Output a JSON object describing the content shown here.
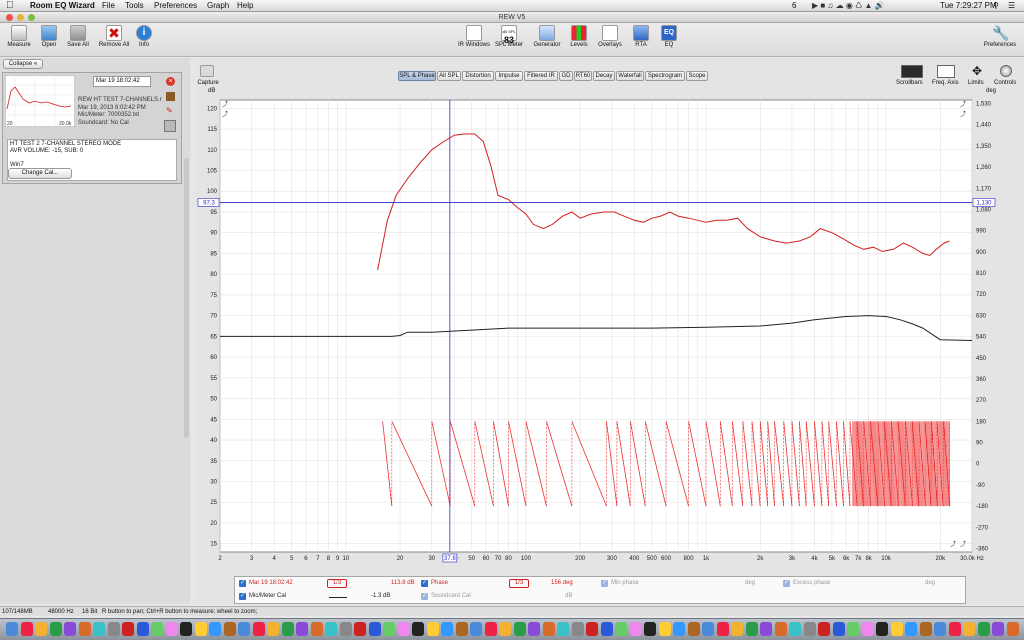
{
  "menubar": {
    "app_name": "Room EQ Wizard",
    "items": [
      "File",
      "Tools",
      "Preferences",
      "Graph",
      "Help"
    ],
    "status_right": "6",
    "clock": "Tue 7:29:27 PM"
  },
  "window": {
    "title": "REW V5"
  },
  "toolbar_left": [
    {
      "label": "Measure",
      "icon": "microphone-icon"
    },
    {
      "label": "Open",
      "icon": "folder-open-icon"
    },
    {
      "label": "Save All",
      "icon": "save-icon"
    },
    {
      "label": "Remove All",
      "icon": "remove-icon"
    },
    {
      "label": "Info",
      "icon": "info-icon"
    }
  ],
  "toolbar_center": [
    {
      "label": "IR Windows",
      "icon": "ir-windows-icon"
    },
    {
      "label": "SPL Meter",
      "icon": "spl-meter-icon",
      "display": "83",
      "display_caption": "dB SPL"
    },
    {
      "label": "Generator",
      "icon": "generator-icon"
    },
    {
      "label": "Levels",
      "icon": "levels-icon"
    },
    {
      "label": "Overlays",
      "icon": "overlays-icon"
    },
    {
      "label": "RTA",
      "icon": "rta-icon"
    },
    {
      "label": "EQ",
      "icon": "eq-icon"
    }
  ],
  "toolbar_right": {
    "label": "Preferences",
    "icon": "wrench-icon"
  },
  "left_panel": {
    "collapse_label": "Collapse",
    "measurement_date": "Mar 19 18:02:42",
    "measurement_info": [
      "REW HT TEST 7-CHANNELS.r",
      "Mar 19, 2013 6:02:42 PM",
      "Mic/Meter: 7000352.txt",
      "Soundcard: No Cal"
    ],
    "thumb_axis_left": "20",
    "thumb_axis_right": "20.0k",
    "notes": [
      "HT TEST 2 7-CHANNEL STEREO MODE",
      "AVR VOLUME: -15, SUB: 0",
      "",
      "Win7"
    ],
    "change_cal_label": "Change Cal..."
  },
  "graph_tabs": [
    "SPL & Phase",
    "All SPL",
    "Distortion",
    "Impulse",
    "Filtered IR",
    "GD",
    "RT60",
    "Decay",
    "Waterfall",
    "Spectrogram",
    "Scope"
  ],
  "active_tab": "SPL & Phase",
  "capture_label": "Capture",
  "graph_tools": [
    "Scrollbars",
    "Freq. Axis",
    "Limits",
    "Controls"
  ],
  "left_unit": "dB",
  "right_unit": "deg",
  "cursor": {
    "spl_readout": "97.3",
    "phase_readout": "1,130",
    "freq_readout": "37.8"
  },
  "legend": {
    "row1": [
      {
        "checked": true,
        "label": "Mar 19 18:02:42",
        "smoothing": "1/3",
        "value": "113.8 dB",
        "color": "#d22020"
      },
      {
        "checked": true,
        "label": "Phase",
        "smoothing": "1/3",
        "value": "156 deg",
        "color": "#d22020"
      },
      {
        "checked": true,
        "label": "Min phase",
        "value": "deg",
        "color": "#999999"
      },
      {
        "checked": true,
        "label": "Excess phase",
        "value": "deg",
        "color": "#999999"
      }
    ],
    "row2": [
      {
        "checked": true,
        "label": "Mic/Meter Cal",
        "value": "-1.3 dB",
        "color": "#222222"
      },
      {
        "checked": true,
        "label": "Soundcard Cal",
        "value": "dB",
        "color": "#999999"
      }
    ]
  },
  "status": {
    "memory": "107/148MB",
    "rate": "48000 Hz",
    "bits": "16 Bit",
    "hint": "R button to pan; Ctrl+R button to measure; wheel to zoom;"
  },
  "chart_data": {
    "type": "line",
    "x_scale": "log",
    "xlim": [
      2,
      30000
    ],
    "ylim": [
      13,
      122
    ],
    "y2lim": [
      -375,
      1545
    ],
    "x_ticks": [
      "2",
      "3",
      "4",
      "5",
      "6",
      "7",
      "8",
      "9",
      "10",
      "20",
      "30",
      "40",
      "50",
      "60",
      "70",
      "80",
      "100",
      "200",
      "300",
      "400",
      "500",
      "600",
      "800",
      "1k",
      "2k",
      "3k",
      "4k",
      "5k",
      "6k",
      "7k",
      "8k",
      "10k",
      "20k",
      "30.0k Hz"
    ],
    "y_ticks": [
      120,
      115,
      110,
      105,
      100,
      95,
      90,
      85,
      80,
      75,
      70,
      65,
      60,
      55,
      50,
      45,
      40,
      35,
      30,
      25,
      20,
      15
    ],
    "y2_ticks": [
      "1,530",
      "1,440",
      "1,350",
      "1,260",
      "1,170",
      "1,080",
      "990",
      "900",
      "810",
      "720",
      "630",
      "540",
      "450",
      "360",
      "270",
      "180",
      "90",
      "0",
      "-90",
      "-180",
      "-270",
      "-360"
    ],
    "grid": true,
    "series": [
      {
        "name": "Mar 19 18:02:42",
        "color": "#d22020",
        "axis": "left",
        "points": [
          [
            15,
            81
          ],
          [
            17,
            93
          ],
          [
            19,
            99
          ],
          [
            22,
            103
          ],
          [
            26,
            107
          ],
          [
            30,
            110
          ],
          [
            35,
            112
          ],
          [
            40,
            113.5
          ],
          [
            45,
            113.8
          ],
          [
            52,
            113.8
          ],
          [
            58,
            112
          ],
          [
            64,
            106
          ],
          [
            70,
            99
          ],
          [
            80,
            98
          ],
          [
            90,
            96
          ],
          [
            100,
            94.5
          ],
          [
            110,
            92
          ],
          [
            125,
            91
          ],
          [
            140,
            92
          ],
          [
            160,
            94
          ],
          [
            180,
            95
          ],
          [
            200,
            93.5
          ],
          [
            230,
            94.5
          ],
          [
            270,
            95
          ],
          [
            310,
            95
          ],
          [
            350,
            94
          ],
          [
            400,
            93
          ],
          [
            450,
            92.5
          ],
          [
            500,
            93.5
          ],
          [
            560,
            94
          ],
          [
            630,
            95
          ],
          [
            700,
            94
          ],
          [
            800,
            93.5
          ],
          [
            900,
            93
          ],
          [
            1000,
            92.5
          ],
          [
            1150,
            93
          ],
          [
            1300,
            93
          ],
          [
            1500,
            93.5
          ],
          [
            1700,
            91
          ],
          [
            2000,
            89
          ],
          [
            2400,
            88
          ],
          [
            2800,
            87.5
          ],
          [
            3300,
            88
          ],
          [
            3800,
            89
          ],
          [
            4300,
            91
          ],
          [
            5000,
            90
          ],
          [
            5800,
            88.5
          ],
          [
            6600,
            87
          ],
          [
            7500,
            86
          ],
          [
            8500,
            86.5
          ],
          [
            9500,
            85.5
          ],
          [
            11000,
            86
          ],
          [
            12500,
            87.5
          ],
          [
            14000,
            86.5
          ],
          [
            16000,
            85
          ],
          [
            17500,
            84.5
          ],
          [
            19000,
            86
          ],
          [
            21000,
            87.5
          ],
          [
            22500,
            88
          ]
        ]
      },
      {
        "name": "Mic/Meter Cal",
        "color": "#222222",
        "axis": "left",
        "points": [
          [
            2,
            65
          ],
          [
            15,
            65
          ],
          [
            18,
            65
          ],
          [
            20,
            65.2
          ],
          [
            22,
            66
          ],
          [
            30,
            66
          ],
          [
            50,
            66.5
          ],
          [
            80,
            67
          ],
          [
            200,
            67
          ],
          [
            500,
            67
          ],
          [
            1000,
            67.2
          ],
          [
            2000,
            67.5
          ],
          [
            3000,
            68.2
          ],
          [
            4000,
            69
          ],
          [
            6000,
            69.8
          ],
          [
            8000,
            70
          ],
          [
            10000,
            69.8
          ],
          [
            12000,
            69
          ],
          [
            14000,
            68
          ],
          [
            16000,
            67
          ],
          [
            18000,
            65.5
          ],
          [
            20000,
            64.2
          ],
          [
            30000,
            64
          ]
        ]
      },
      {
        "name": "Phase",
        "color": "#ee3030",
        "axis": "right",
        "type": "phase-wrap",
        "wrap_freqs": [
          16,
          18,
          30,
          38,
          52,
          66,
          80,
          100,
          130,
          180,
          280,
          320,
          380,
          460,
          600,
          800,
          1000,
          1200,
          1400,
          1600,
          1800,
          2000,
          2200,
          2400,
          2700,
          3000,
          3300,
          3600,
          4000,
          4400,
          4800,
          5300,
          5800,
          6300,
          6900,
          7500,
          8200,
          9000,
          9800,
          10700,
          11700,
          12800,
          14000,
          15200,
          16500,
          17800,
          19200,
          20800,
          22500
        ],
        "range": [
          -180,
          180
        ]
      }
    ]
  }
}
